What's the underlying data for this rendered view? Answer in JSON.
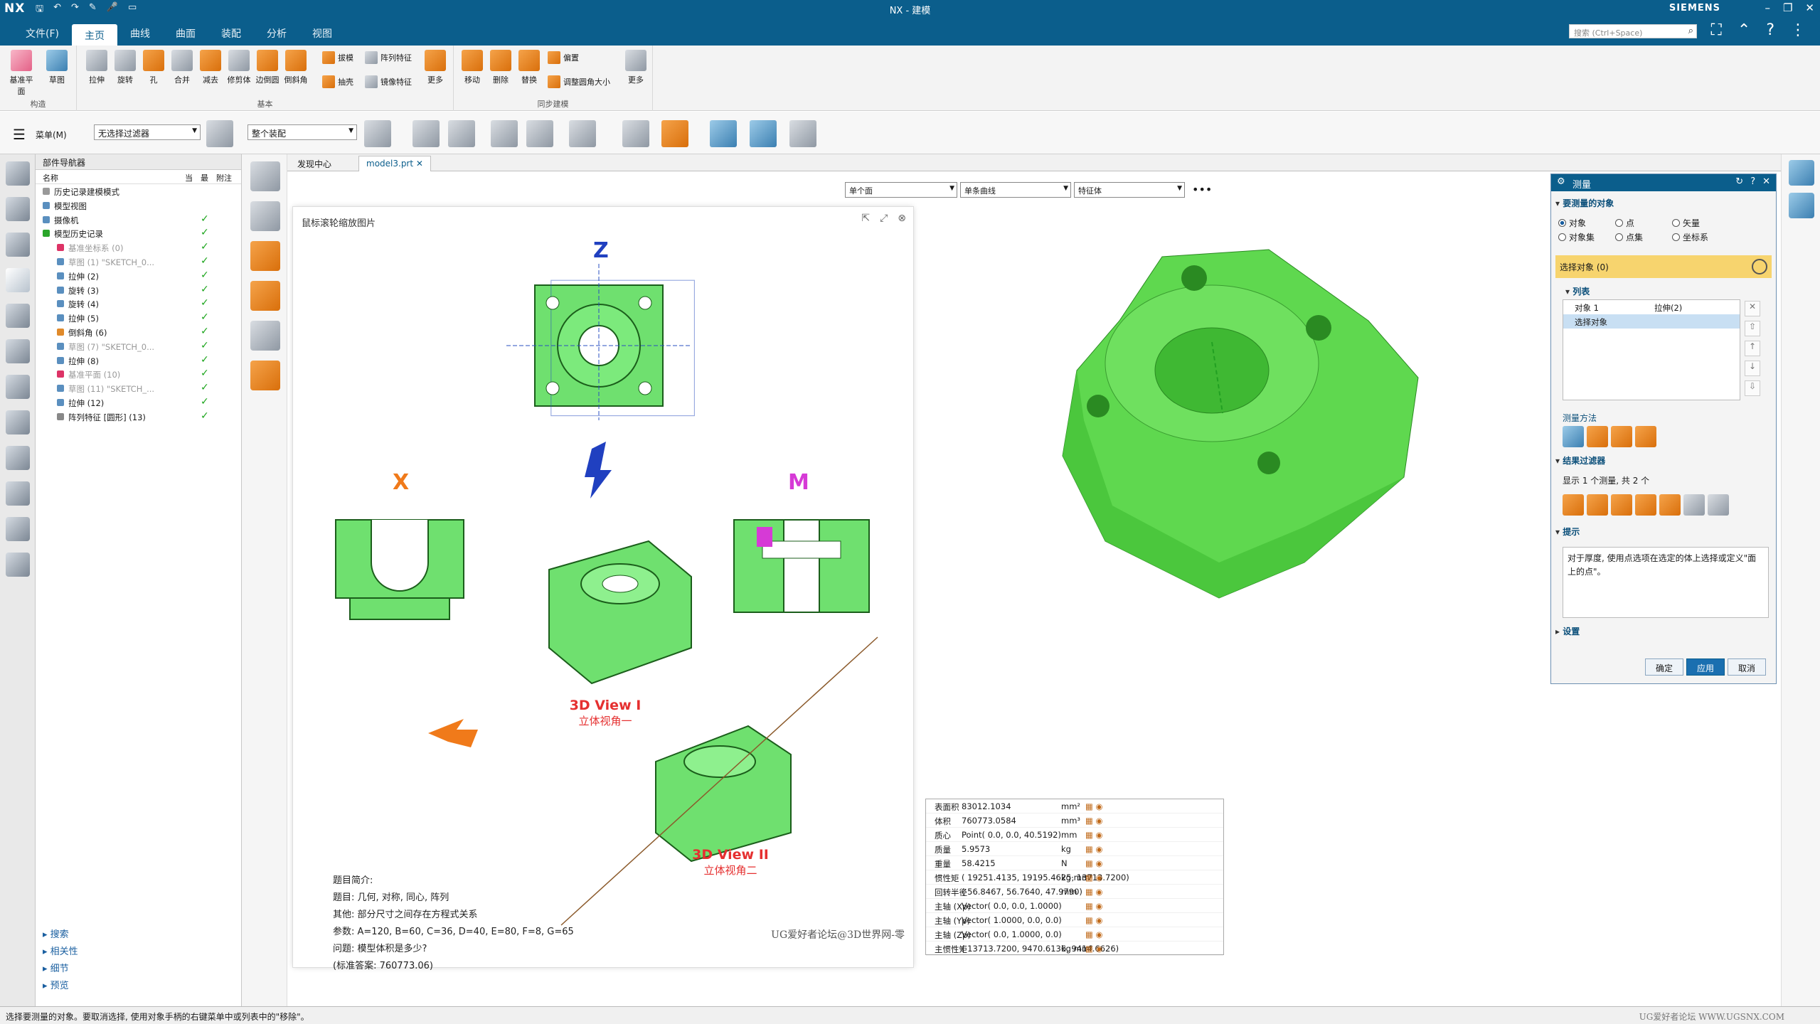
{
  "title_bar": {
    "app_logo": "NX",
    "window_title": "NX - 建模",
    "vendor": "SIEMENS",
    "quick_access": [
      "保存",
      "撤销",
      "重做",
      "草图",
      "语音",
      "窗口"
    ]
  },
  "menu": {
    "tabs": [
      "文件(F)",
      "主页",
      "曲线",
      "曲面",
      "装配",
      "分析",
      "视图"
    ],
    "active_tab": "主页",
    "search_placeholder": "搜索 (Ctrl+Space)"
  },
  "ribbon": {
    "groups": [
      {
        "label": "构造",
        "buttons": [
          "基准平面",
          "草图"
        ]
      },
      {
        "label": "基本",
        "buttons": [
          "拉伸",
          "旋转",
          "孔",
          "合并",
          "减去",
          "修剪体",
          "边倒圆",
          "倒斜角"
        ],
        "small": [
          "拔模",
          "阵列特征",
          "抽壳",
          "镜像特征",
          "更多"
        ]
      },
      {
        "label": "同步建模",
        "buttons": [
          "移动",
          "删除",
          "替换",
          "更多"
        ],
        "small": [
          "偏置",
          "调整圆角大小"
        ]
      }
    ]
  },
  "selection_bar": {
    "menu_label": "菜单(M)",
    "filter_value": "无选择过滤器",
    "scope_value": "整个装配"
  },
  "part_navigator": {
    "title": "部件导航器",
    "columns": [
      "名称",
      "当",
      "最",
      "附注"
    ],
    "rows": [
      {
        "label": "历史记录建模模式",
        "dim": false,
        "check": false
      },
      {
        "label": "模型视图",
        "dim": false,
        "check": false
      },
      {
        "label": "摄像机",
        "dim": false,
        "check": true
      },
      {
        "label": "模型历史记录",
        "dim": false,
        "check": true
      },
      {
        "label": "基准坐标系 (0)",
        "dim": true,
        "check": true
      },
      {
        "label": "草图 (1) \"SKETCH_0...",
        "dim": true,
        "check": true
      },
      {
        "label": "拉伸 (2)",
        "dim": false,
        "check": true
      },
      {
        "label": "旋转 (3)",
        "dim": false,
        "check": true
      },
      {
        "label": "旋转 (4)",
        "dim": false,
        "check": true
      },
      {
        "label": "拉伸 (5)",
        "dim": false,
        "check": true
      },
      {
        "label": "倒斜角 (6)",
        "dim": false,
        "check": true
      },
      {
        "label": "草图 (7) \"SKETCH_0...",
        "dim": true,
        "check": true
      },
      {
        "label": "拉伸 (8)",
        "dim": false,
        "check": true
      },
      {
        "label": "基准平面 (10)",
        "dim": true,
        "check": true
      },
      {
        "label": "草图 (11) \"SKETCH_...",
        "dim": true,
        "check": true
      },
      {
        "label": "拉伸 (12)",
        "dim": false,
        "check": true
      },
      {
        "label": "阵列特征 [圆形] (13)",
        "dim": false,
        "check": true
      }
    ],
    "bottom_sections": [
      "搜索",
      "相关性",
      "细节",
      "预览"
    ]
  },
  "doc_tabs": [
    "发现中心",
    "model3.prt"
  ],
  "active_doc": "model3.prt",
  "graphics_filters": [
    "单个面",
    "单条曲线",
    "特征体"
  ],
  "image_panel": {
    "title": "鼠标滚轮缩放图片",
    "axis_labels": {
      "z": "Z",
      "x": "X",
      "m": "M",
      "z3d": "Z",
      "m3d": "M"
    },
    "view1": {
      "en": "3D View I",
      "cn": "立体视角一"
    },
    "view2": {
      "en": "3D View II",
      "cn": "立体视角二"
    },
    "notes": [
      "题目简介:",
      "题目: 几何, 对称, 同心, 阵列",
      "其他: 部分尺寸之间存在方程式关系",
      "参数: A=120,   B=60,   C=36,   D=40,   E=80,   F=8,   G=65",
      "问题: 模型体积是多少?",
      "(标准答案: 760773.06)"
    ],
    "source": "UG爱好者论坛@3D世界网-零"
  },
  "results": [
    {
      "name": "表面积",
      "value": "83012.1034",
      "unit": "mm²"
    },
    {
      "name": "体积",
      "value": "760773.0584",
      "unit": "mm³"
    },
    {
      "name": "质心",
      "value": "Point( 0.0, 0.0, 40.5192)",
      "unit": "mm"
    },
    {
      "name": "质量",
      "value": "5.9573",
      "unit": "kg"
    },
    {
      "name": "重量",
      "value": "58.4215",
      "unit": "N"
    },
    {
      "name": "惯性矩",
      "value": "( 19251.4135, 19195.4625, 13713.7200)",
      "unit": "kg·mm²"
    },
    {
      "name": "回转半径",
      "value": "( 56.8467, 56.7640, 47.9790)",
      "unit": "mm"
    },
    {
      "name": "主轴 (Xp)",
      "value": "Vector( 0.0, 0.0, 1.0000)",
      "unit": ""
    },
    {
      "name": "主轴 (Yp)",
      "value": "Vector( 1.0000, 0.0, 0.0)",
      "unit": ""
    },
    {
      "name": "主轴 (Zp)",
      "value": "Vector( 0.0, 1.0000, 0.0)",
      "unit": ""
    },
    {
      "name": "主惯性矩",
      "value": "( 13713.7200, 9470.6136, 9414.6626)",
      "unit": "kg·mm²"
    }
  ],
  "measure_dialog": {
    "title": "测量",
    "section_objects": "要测量的对象",
    "radios": [
      {
        "label": "对象",
        "on": true
      },
      {
        "label": "点",
        "on": false
      },
      {
        "label": "矢量",
        "on": false
      },
      {
        "label": "对象集",
        "on": false
      },
      {
        "label": "点集",
        "on": false
      },
      {
        "label": "坐标系",
        "on": false
      }
    ],
    "select_label": "选择对象 (0)",
    "section_list": "列表",
    "list_rows": [
      {
        "c1": "对象 1",
        "c2": "拉伸(2)"
      },
      {
        "c1": "选择对象",
        "c2": ""
      }
    ],
    "section_method": "测量方法",
    "section_filter": "结果过滤器",
    "filter_summary": "显示 1 个测量, 共 2 个",
    "section_hint": "提示",
    "hint_text": "对于厚度, 使用点选项在选定的体上选择或定义\"面上的点\"。",
    "section_settings": "设置",
    "buttons": [
      "确定",
      "应用",
      "取消"
    ]
  },
  "status": {
    "message": "选择要测量的对象。要取消选择, 使用对象手柄的右键菜单中或列表中的\"移除\"。",
    "watermark": "UG爱好者论坛 WWW.UGSNX.COM"
  }
}
